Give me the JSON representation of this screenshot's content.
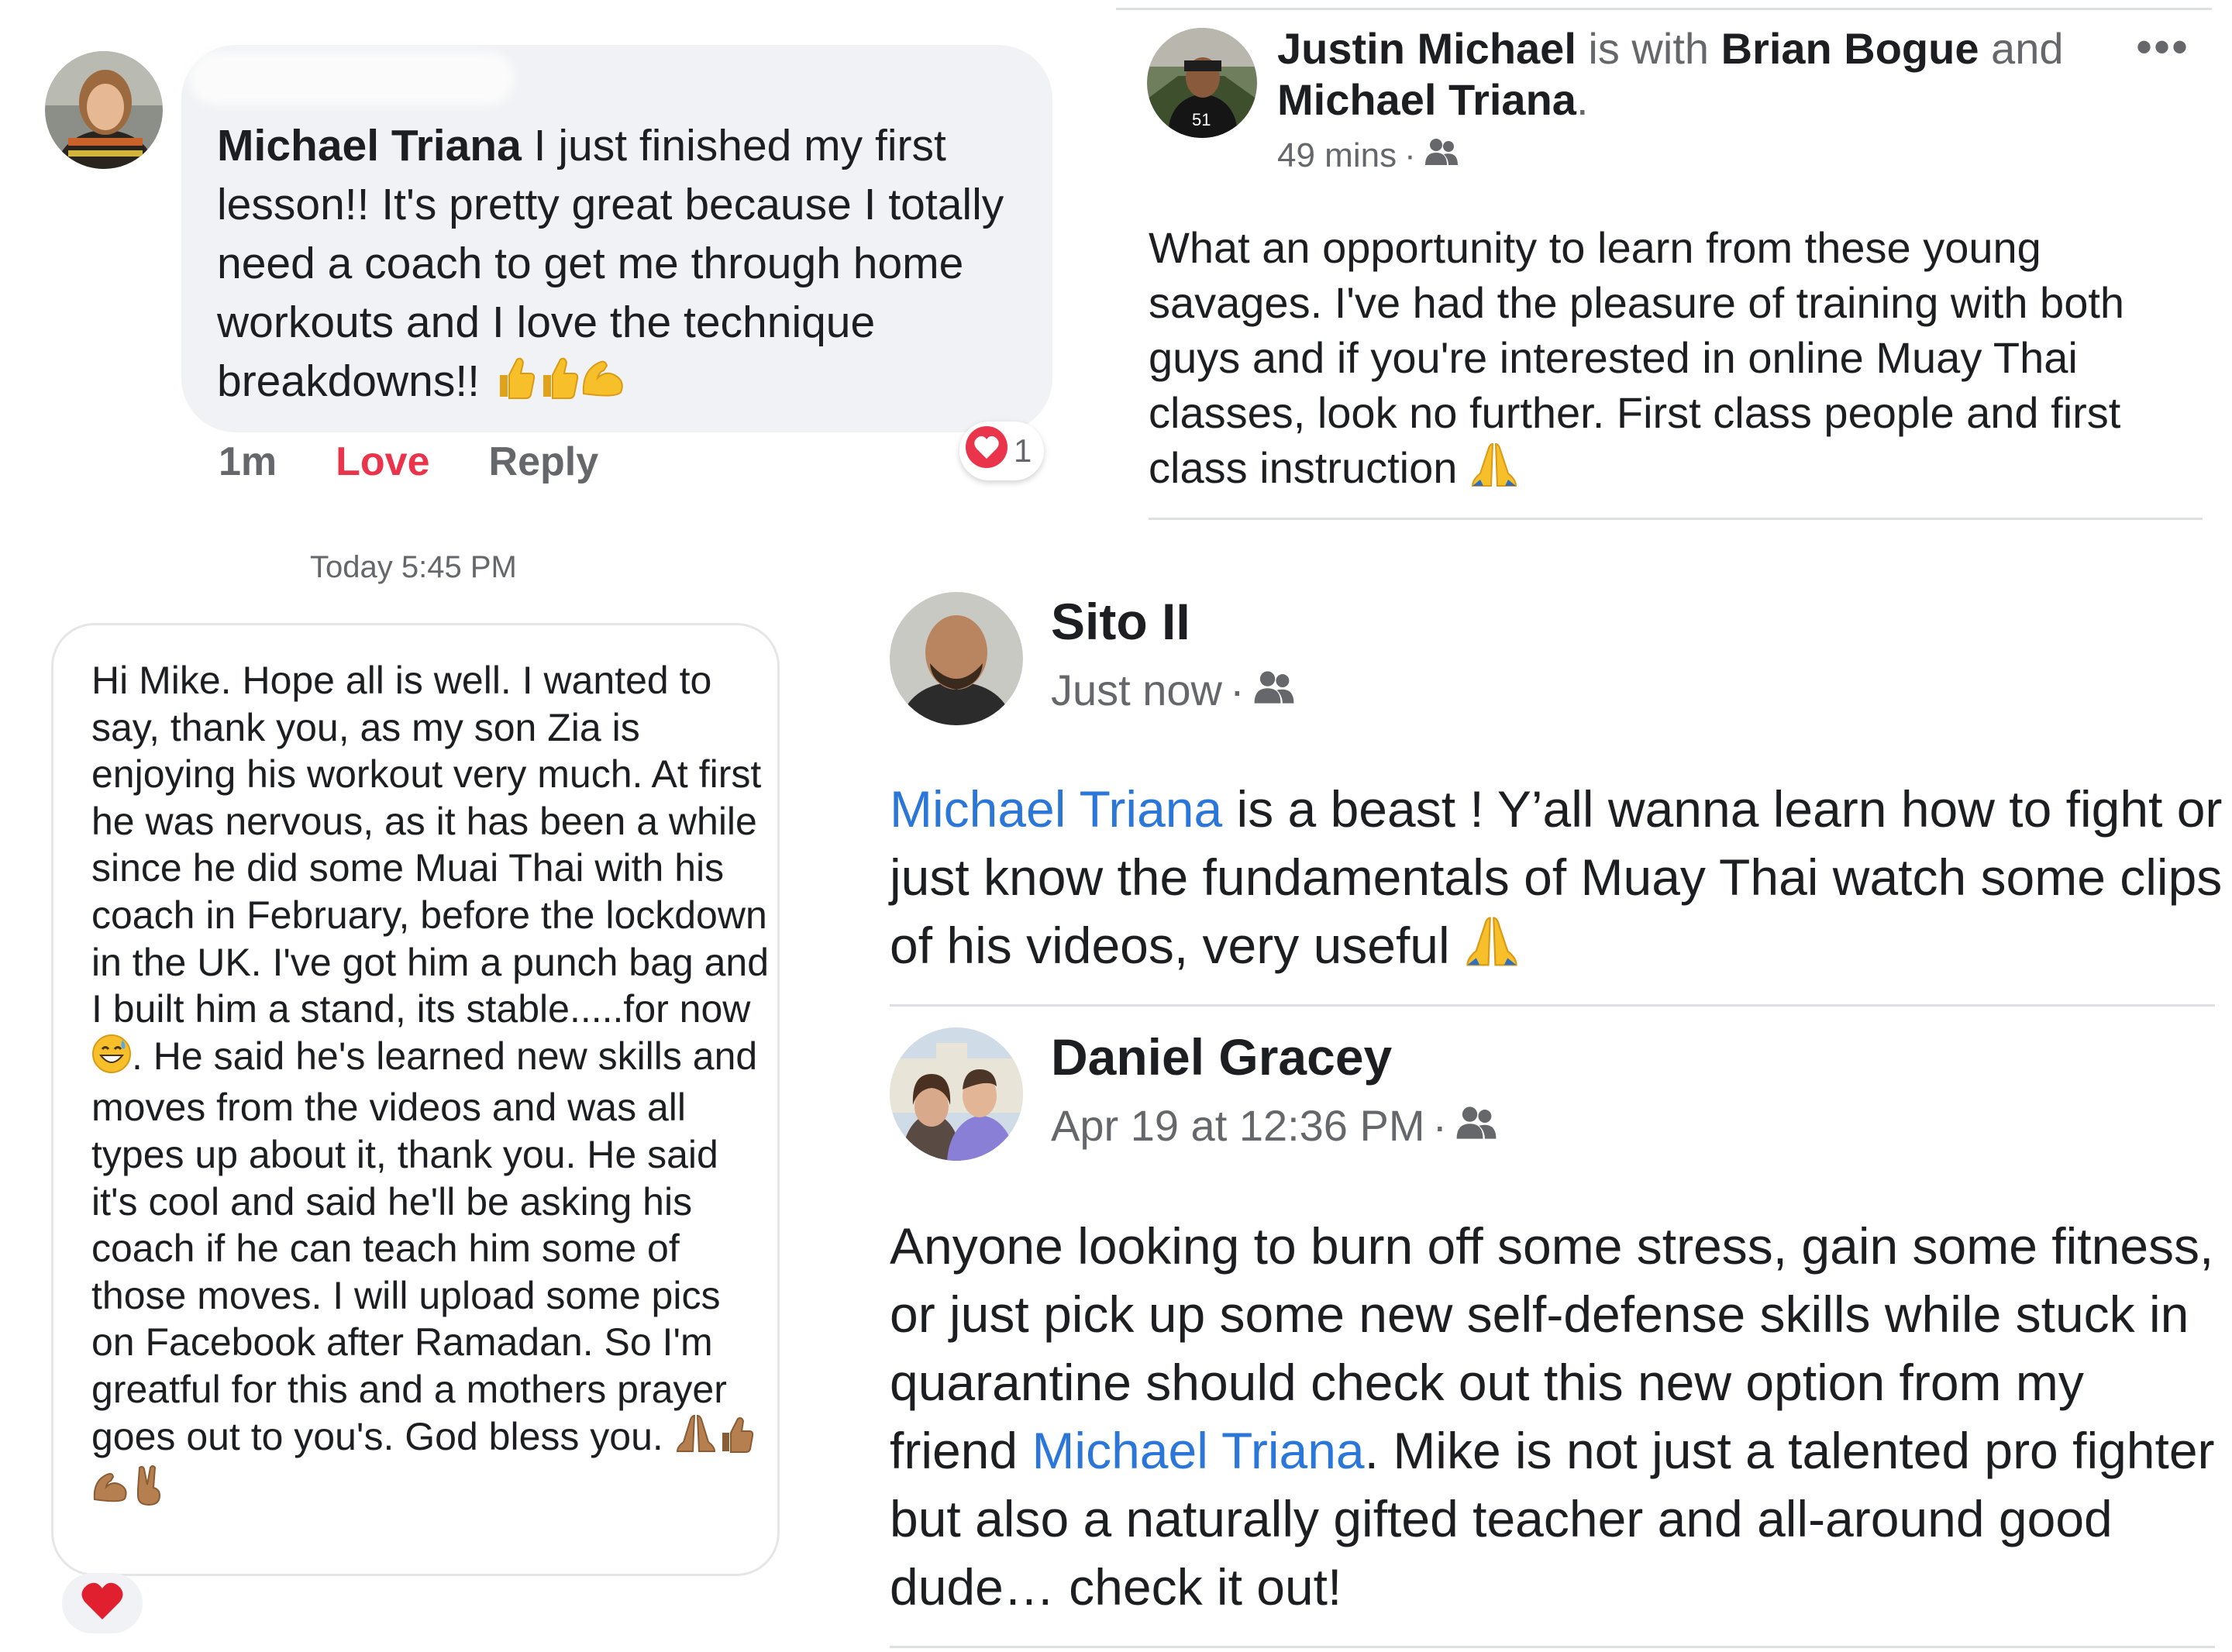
{
  "comment": {
    "author": "Michael Triana",
    "text": " I just finished my first lesson!!  It's pretty great because I totally need a coach to get me through home workouts and I love the technique breakdowns!! ",
    "emojis": [
      "thumbs-up-icon",
      "thumbs-up-icon",
      "flexed-biceps-icon"
    ],
    "time": "1m",
    "love_label": "Love",
    "reply_label": "Reply",
    "reaction_count": "1"
  },
  "post_justin": {
    "author": "Justin Michael",
    "with_text": " is with ",
    "tagged_1": "Brian Bogue",
    "and_text": " and ",
    "tagged_2": "Michael Triana",
    "period": ".",
    "time": "49 mins",
    "dot": "·",
    "more": "•••",
    "body": "What an opportunity to learn from these young savages. I've had the pleasure of training with both guys and if you're interested in online Muay Thai classes, look no further. First class people and first class instruction "
  },
  "message": {
    "timestamp": "Today 5:45 PM",
    "text": "Hi Mike. Hope all is well. I wanted to say, thank you, as my son Zia is enjoying his workout very much. At first he was nervous, as it has been a while since he did some Muai Thai with his coach in February, before the lockdown in the UK. I've got him a punch bag and I built him a stand, its stable.....for now ",
    "text_2": ". He said he's learned new skills and moves from the videos and was all types up about it, thank you. He said it's cool and said he'll be asking his coach if he can teach him some of those moves. I will upload some pics on Facebook after Ramadan. So I'm greatful for this and a mothers prayer goes out to you's. God bless you. "
  },
  "post_sito": {
    "author": "Sito II",
    "time": "Just now",
    "dot": "·",
    "mention": "Michael Triana",
    "body": " is a beast ! Y’all wanna learn how to fight or just know the fundamentals of Muay Thai watch some clips of his videos, very useful "
  },
  "post_daniel": {
    "author": "Daniel Gracey",
    "time": "Apr 19 at 12:36 PM",
    "dot": "·",
    "body_1": "Anyone looking to burn off some stress, gain some fitness, or just pick up some new self-defense skills while stuck in quarantine should check out this new option from my friend ",
    "mention": "Michael Triana",
    "body_2": ". Mike is not just a talented pro fighter but also a naturally gifted teacher and all-around good dude… check it out!"
  },
  "colors": {
    "link_blue": "#2b76d9",
    "love_red": "#e9344b",
    "meta_gray": "#65676b",
    "bubble_gray": "#f0f2f5"
  }
}
